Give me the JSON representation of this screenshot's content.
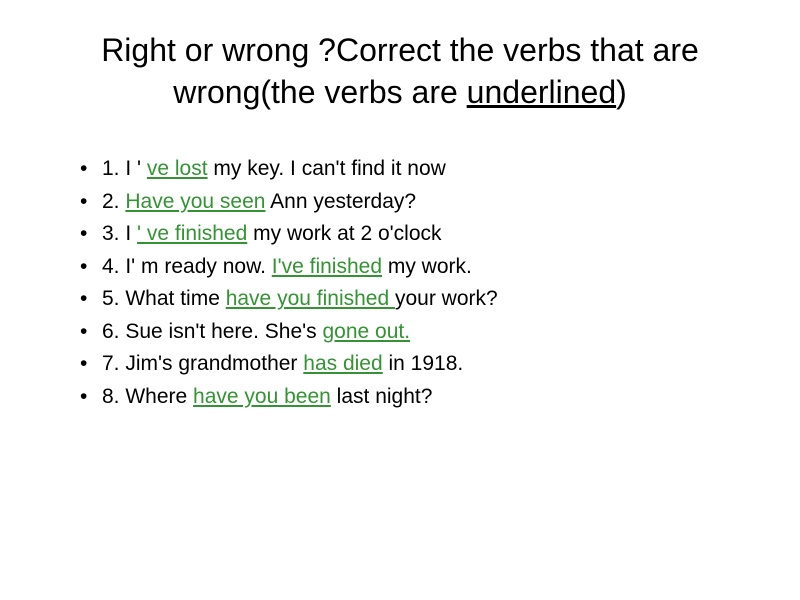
{
  "title": {
    "part1": "Right or wrong ?Correct the verbs  that are wrong(the verbs are ",
    "underlined": "underlined",
    "part2": ")"
  },
  "items": [
    {
      "pre": "1. I ' ",
      "verb": "ve lost",
      "post": " my key. I can't find it now"
    },
    {
      "pre": "2. ",
      "verb": "Have you seen",
      "post": " Ann yesterday?"
    },
    {
      "pre": "3. I ",
      "verb": "' ve finished",
      "post": " my work at  2 o'clock"
    },
    {
      "pre": "4. I' m ready now. ",
      "verb": "I've finished",
      "post": " my work."
    },
    {
      "pre": "5. What time ",
      "verb": "have you finished ",
      "post": "your work?"
    },
    {
      "pre": "6. Sue isn't here. She's ",
      "verb": "gone out.",
      "post": ""
    },
    {
      "pre": "7. Jim's grandmother ",
      "verb": "has died",
      "post": " in 1918."
    },
    {
      "pre": "8. Where ",
      "verb": "have you been",
      "post": " last night?"
    }
  ]
}
